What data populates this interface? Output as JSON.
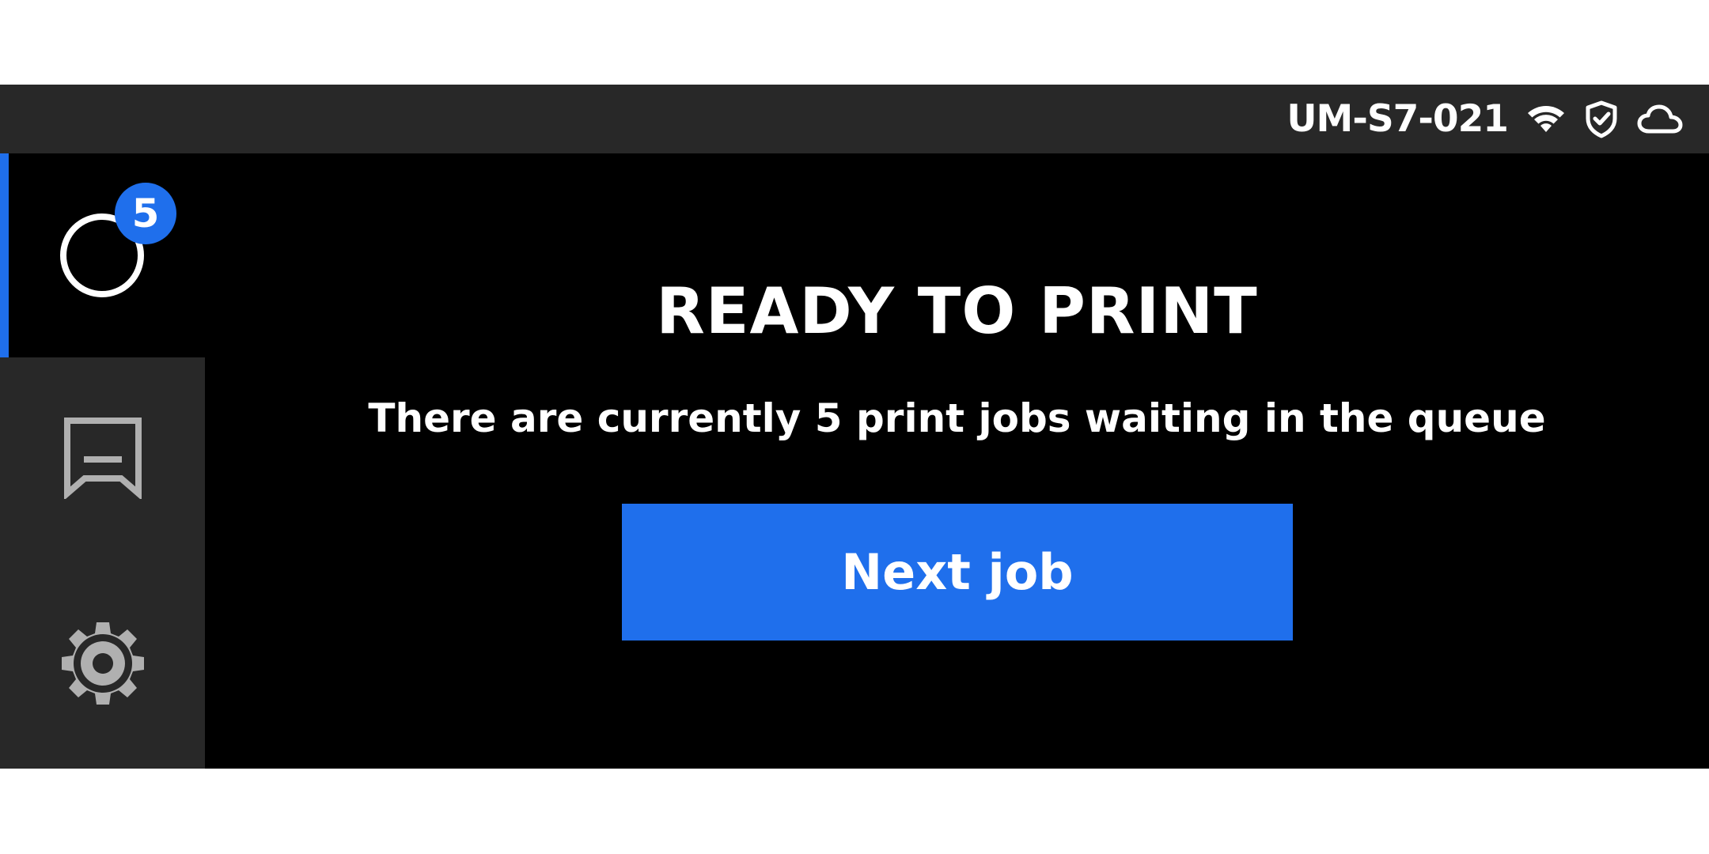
{
  "status_bar": {
    "printer_name": "UM-S7-021",
    "icons": [
      "wifi-icon",
      "shield-check-icon",
      "cloud-icon"
    ]
  },
  "sidebar": {
    "items": [
      {
        "name": "status",
        "icon": "status-circle-icon",
        "badge": "5",
        "active": true
      },
      {
        "name": "queue",
        "icon": "queue-tray-icon",
        "active": false
      },
      {
        "name": "settings",
        "icon": "gear-icon",
        "active": false
      }
    ]
  },
  "main": {
    "title": "READY TO PRINT",
    "subtitle": "There are currently 5 print jobs waiting in the queue",
    "button_label": "Next job"
  },
  "colors": {
    "accent": "#1f6fec",
    "panel": "#282828",
    "background": "#000000",
    "icon_gray": "#b0b0b0"
  }
}
